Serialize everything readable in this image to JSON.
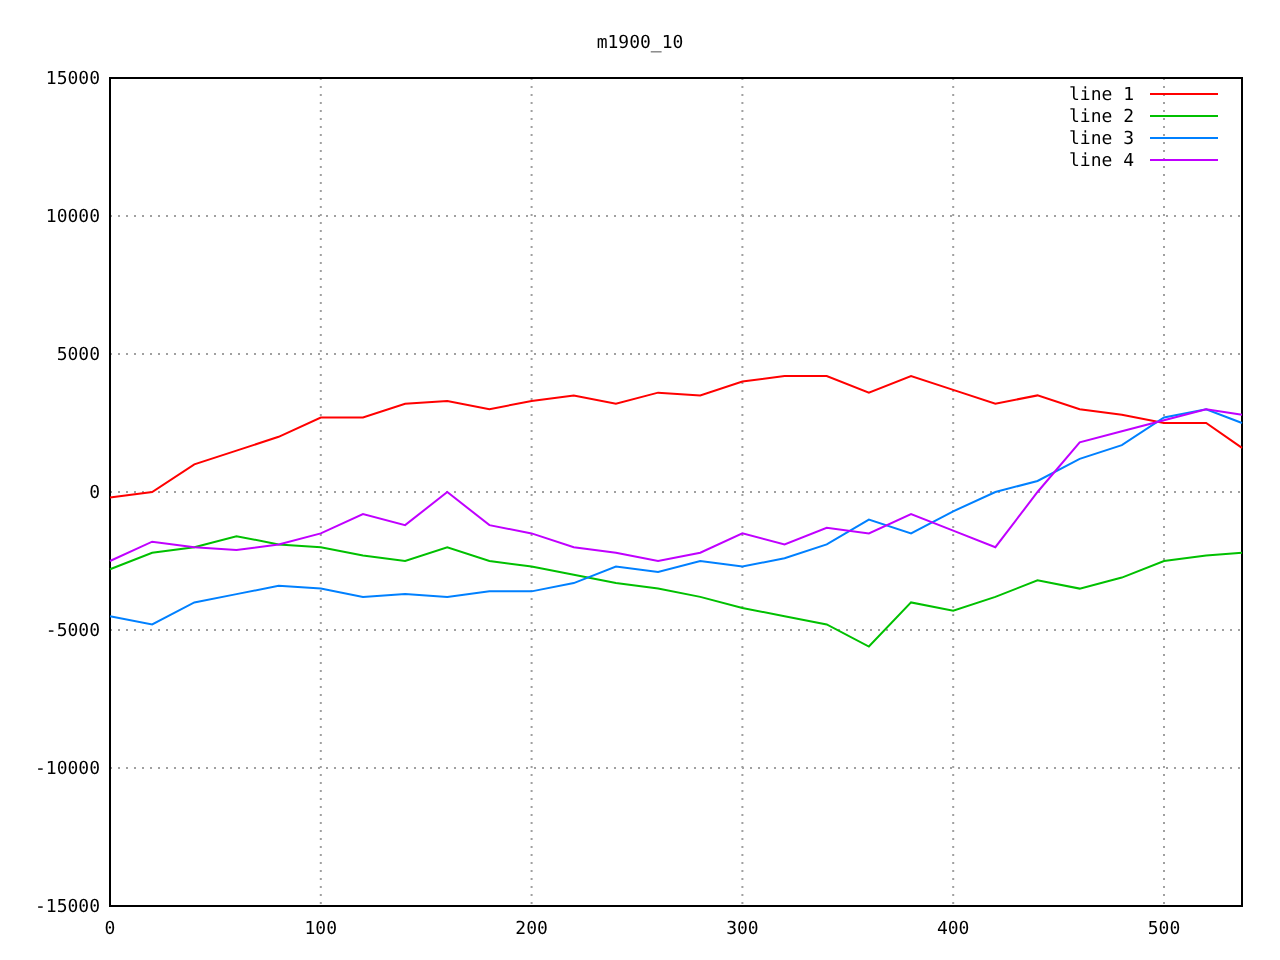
{
  "chart_data": {
    "type": "line",
    "title": "m1900_10",
    "xlim": [
      0,
      537
    ],
    "ylim": [
      -15000,
      15000
    ],
    "grid": true,
    "legend": true,
    "xticks": [
      0,
      100,
      200,
      300,
      400,
      500
    ],
    "yticks": [
      -15000,
      -10000,
      -5000,
      0,
      5000,
      10000,
      15000
    ],
    "x": [
      0,
      20,
      40,
      60,
      80,
      100,
      120,
      140,
      160,
      180,
      200,
      220,
      240,
      260,
      280,
      300,
      320,
      340,
      360,
      380,
      400,
      420,
      440,
      460,
      480,
      500,
      520,
      537
    ],
    "series": [
      {
        "name": "line 1",
        "color": "#ff0000",
        "values": [
          -200,
          0,
          1000,
          1500,
          2000,
          2700,
          2700,
          3200,
          3300,
          3000,
          3300,
          3500,
          3200,
          3600,
          3500,
          4000,
          4200,
          4200,
          3600,
          4200,
          3700,
          3200,
          3500,
          3000,
          2800,
          2500,
          2500,
          1600
        ]
      },
      {
        "name": "line 2",
        "color": "#00c000",
        "values": [
          -2800,
          -2200,
          -2000,
          -1600,
          -1900,
          -2000,
          -2300,
          -2500,
          -2000,
          -2500,
          -2700,
          -3000,
          -3300,
          -3500,
          -3800,
          -4200,
          -4500,
          -4800,
          -5600,
          -4000,
          -4300,
          -3800,
          -3200,
          -3500,
          -3100,
          -2500,
          -2300,
          -2200
        ]
      },
      {
        "name": "line 3",
        "color": "#0080ff",
        "values": [
          -4500,
          -4800,
          -4000,
          -3700,
          -3400,
          -3500,
          -3800,
          -3700,
          -3800,
          -3600,
          -3600,
          -3300,
          -2700,
          -2900,
          -2500,
          -2700,
          -2400,
          -1900,
          -1000,
          -1500,
          -700,
          0,
          400,
          1200,
          1700,
          2700,
          3000,
          2500
        ]
      },
      {
        "name": "line 4",
        "color": "#c000ff",
        "values": [
          -2500,
          -1800,
          -2000,
          -2100,
          -1900,
          -1500,
          -800,
          -1200,
          0,
          -1200,
          -1500,
          -2000,
          -2200,
          -2500,
          -2200,
          -1500,
          -1900,
          -1300,
          -1500,
          -800,
          -1400,
          -2000,
          0,
          1800,
          2200,
          2600,
          3000,
          2800
        ]
      }
    ]
  }
}
